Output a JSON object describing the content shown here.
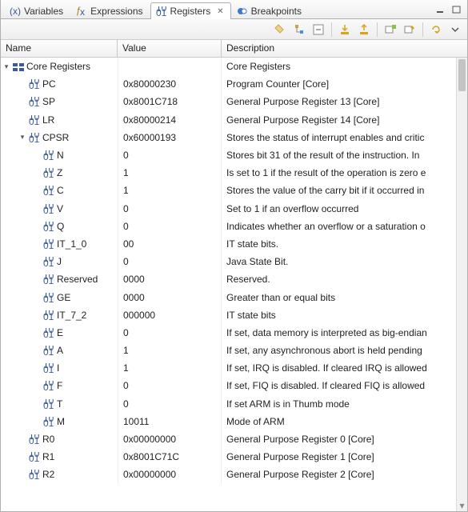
{
  "tabs": {
    "variables": "Variables",
    "expressions": "Expressions",
    "registers": "Registers",
    "breakpoints": "Breakpoints"
  },
  "columns": {
    "name": "Name",
    "value": "Value",
    "description": "Description"
  },
  "root": {
    "name": "Core Registers",
    "value": "",
    "desc": "Core Registers"
  },
  "regs": [
    {
      "name": "PC",
      "value": "0x80000230",
      "desc": "Program Counter [Core]",
      "indent": 1
    },
    {
      "name": "SP",
      "value": "0x8001C718",
      "desc": "General Purpose Register 13 [Core]",
      "indent": 1
    },
    {
      "name": "LR",
      "value": "0x80000214",
      "desc": "General Purpose Register 14 [Core]",
      "indent": 1
    },
    {
      "name": "CPSR",
      "value": "0x60000193",
      "desc": "Stores the status of interrupt enables and critic",
      "indent": 1,
      "expanded": true
    },
    {
      "name": "N",
      "value": "0",
      "desc": "Stores bit 31 of the result of the instruction. In",
      "indent": 2
    },
    {
      "name": "Z",
      "value": "1",
      "desc": "Is set to 1 if the result of the operation is zero e",
      "indent": 2
    },
    {
      "name": "C",
      "value": "1",
      "desc": "Stores the value of the carry bit if it occurred in",
      "indent": 2
    },
    {
      "name": "V",
      "value": "0",
      "desc": "Set to 1 if an overflow occurred",
      "indent": 2
    },
    {
      "name": "Q",
      "value": "0",
      "desc": "Indicates whether an overflow or a saturation o",
      "indent": 2
    },
    {
      "name": "IT_1_0",
      "value": "00",
      "desc": "IT state bits.",
      "indent": 2
    },
    {
      "name": "J",
      "value": "0",
      "desc": "Java State Bit.",
      "indent": 2
    },
    {
      "name": "Reserved",
      "value": "0000",
      "desc": "Reserved.",
      "indent": 2
    },
    {
      "name": "GE",
      "value": "0000",
      "desc": "Greater than or equal bits",
      "indent": 2
    },
    {
      "name": "IT_7_2",
      "value": "000000",
      "desc": "IT state bits",
      "indent": 2
    },
    {
      "name": "E",
      "value": "0",
      "desc": "If set, data memory is interpreted as big-endian",
      "indent": 2
    },
    {
      "name": "A",
      "value": "1",
      "desc": "If set, any asynchronous abort is held pending",
      "indent": 2
    },
    {
      "name": "I",
      "value": "1",
      "desc": "If set, IRQ is disabled. If cleared IRQ is allowed",
      "indent": 2
    },
    {
      "name": "F",
      "value": "0",
      "desc": "If set, FIQ is disabled. If cleared FIQ is allowed",
      "indent": 2
    },
    {
      "name": "T",
      "value": "0",
      "desc": "If set ARM is in Thumb mode",
      "indent": 2
    },
    {
      "name": "M",
      "value": "10011",
      "desc": "Mode of ARM",
      "indent": 2
    },
    {
      "name": "R0",
      "value": "0x00000000",
      "desc": "General Purpose Register 0 [Core]",
      "indent": 1
    },
    {
      "name": "R1",
      "value": "0x8001C71C",
      "desc": "General Purpose Register 1 [Core]",
      "indent": 1
    },
    {
      "name": "R2",
      "value": "0x00000000",
      "desc": "General Purpose Register 2 [Core]",
      "indent": 1
    }
  ]
}
